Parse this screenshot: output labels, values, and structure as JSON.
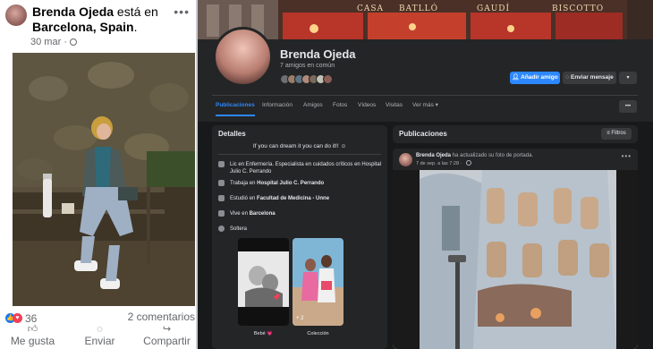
{
  "left_post": {
    "author": "Brenda Ojeda",
    "is_in": "está en",
    "location": "Barcelona, Spain",
    "location_suffix": ".",
    "date": "30 mar",
    "date_sep": "·",
    "reaction_count": "36",
    "comments": "2 comentarios",
    "actions": {
      "like": "Me gusta",
      "send": "Enviar",
      "share": "Compartir"
    }
  },
  "cover": {
    "signs": [
      "CASA",
      "BATLLÓ",
      "GAUDÍ",
      "BISCOTTO"
    ]
  },
  "profile": {
    "name": "Brenda Ojeda",
    "friends": "7 amigos en común",
    "add_friend": "Añadir amigo",
    "send_message": "Enviar mensaje"
  },
  "tabs": [
    "Publicaciones",
    "Información",
    "Amigos",
    "Fotos",
    "Vídeos",
    "Visitas",
    "Ver más ▾"
  ],
  "details": {
    "title": "Detalles",
    "bio": "If you can dream it you can do it!! ☺",
    "items": [
      {
        "pre": "Lic en Enfermería. Especialista en cuidados críticos en Hospital Julio C. Perrando",
        "bold": ""
      },
      {
        "pre": "Trabaja en ",
        "bold": "Hospital Julio C. Perrando"
      },
      {
        "pre": "Estudió en ",
        "bold": "Facultad de Medicina - Unne"
      },
      {
        "pre": "Vive en ",
        "bold": "Barcelona"
      },
      {
        "pre": "Soltera",
        "bold": ""
      }
    ],
    "featured": [
      {
        "label": "Bebé 💗",
        "count": ""
      },
      {
        "label": "Colección",
        "count": "+ 2"
      }
    ]
  },
  "posts": {
    "title": "Publicaciones",
    "filter": "Filtros",
    "card": {
      "author": "Brenda Ojeda",
      "action": " ha actualizado su foto de portada.",
      "date": "7 de sep. a las 7:28 · "
    }
  },
  "colors": {
    "fb_blue": "#2d88ff",
    "dark_bg": "#18191a",
    "card_bg": "#242526"
  }
}
